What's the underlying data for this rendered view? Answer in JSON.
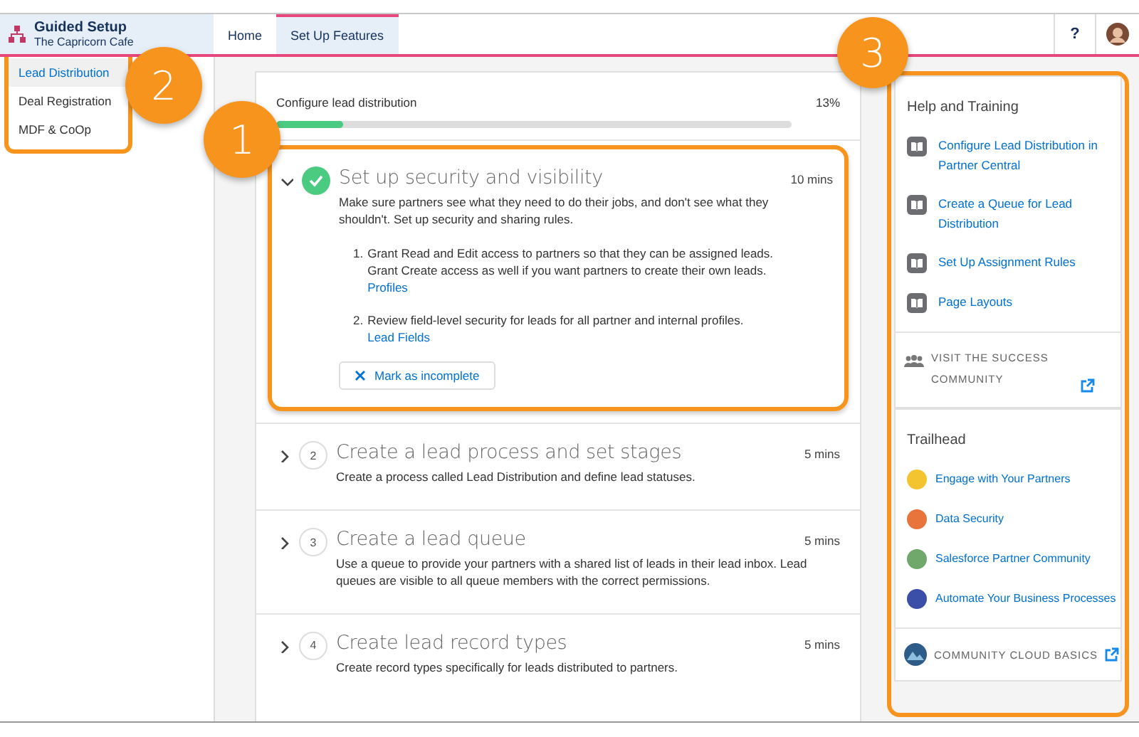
{
  "header": {
    "app_title": "Guided Setup",
    "org_name": "The Capricorn Cafe",
    "tabs": [
      {
        "label": "Home",
        "selected": false
      },
      {
        "label": "Set Up Features",
        "selected": true
      }
    ],
    "help_button": "?"
  },
  "sidebar": {
    "callout": "2",
    "items": [
      {
        "label": "Lead Distribution",
        "selected": true
      },
      {
        "label": "Deal Registration",
        "selected": false
      },
      {
        "label": "MDF & CoOp",
        "selected": false
      }
    ]
  },
  "progress": {
    "title": "Configure lead distribution",
    "percent": "13%",
    "level": 0.13
  },
  "steps": [
    {
      "completed": true,
      "expanded": true,
      "callout": "1",
      "title": "Set up security and visibility",
      "duration": "10 mins",
      "description": "Make sure partners see what they need to do their jobs, and don't see what they shouldn't. Set up security and sharing rules.",
      "instructions": [
        {
          "marker": "1.",
          "text": "Grant Read and Edit access to partners so that they can be assigned leads. Grant Create access as well if you want partners to create their own leads.",
          "link": "Profiles"
        },
        {
          "marker": "2.",
          "text": "Review field-level security for leads for all partner and internal profiles.",
          "link": "Lead Fields"
        }
      ],
      "button": "Mark as incomplete"
    },
    {
      "completed": false,
      "expanded": false,
      "number": "2",
      "title": "Create a lead process and set stages",
      "duration": "5 mins",
      "description": "Create a process called Lead Distribution and define lead statuses."
    },
    {
      "completed": false,
      "expanded": false,
      "number": "3",
      "title": "Create a lead queue",
      "duration": "5 mins",
      "description": "Use a queue to provide your partners with a shared list of leads in their lead inbox. Lead queues are visible to all queue members with the correct permissions."
    },
    {
      "completed": false,
      "expanded": false,
      "number": "4",
      "title": "Create lead record types",
      "duration": "5 mins",
      "description": "Create record types specifically for leads distributed to partners."
    }
  ],
  "help": {
    "callout": "3",
    "title": "Help and Training",
    "links": [
      "Configure Lead Distribution in Partner Central",
      "Create a Queue for Lead Distribution",
      "Set Up Assignment Rules",
      "Page Layouts"
    ],
    "community_link": "VISIT THE SUCCESS COMMUNITY"
  },
  "trailhead": {
    "title": "Trailhead",
    "modules": [
      {
        "label": "Engage with Your Partners",
        "color": "#f4c430"
      },
      {
        "label": "Data Security",
        "color": "#e8743b"
      },
      {
        "label": "Salesforce Partner Community",
        "color": "#6fa86a"
      },
      {
        "label": "Automate Your Business Processes",
        "color": "#3b4fa8"
      }
    ],
    "footer_link": "COMMUNITY CLOUD BASICS"
  }
}
